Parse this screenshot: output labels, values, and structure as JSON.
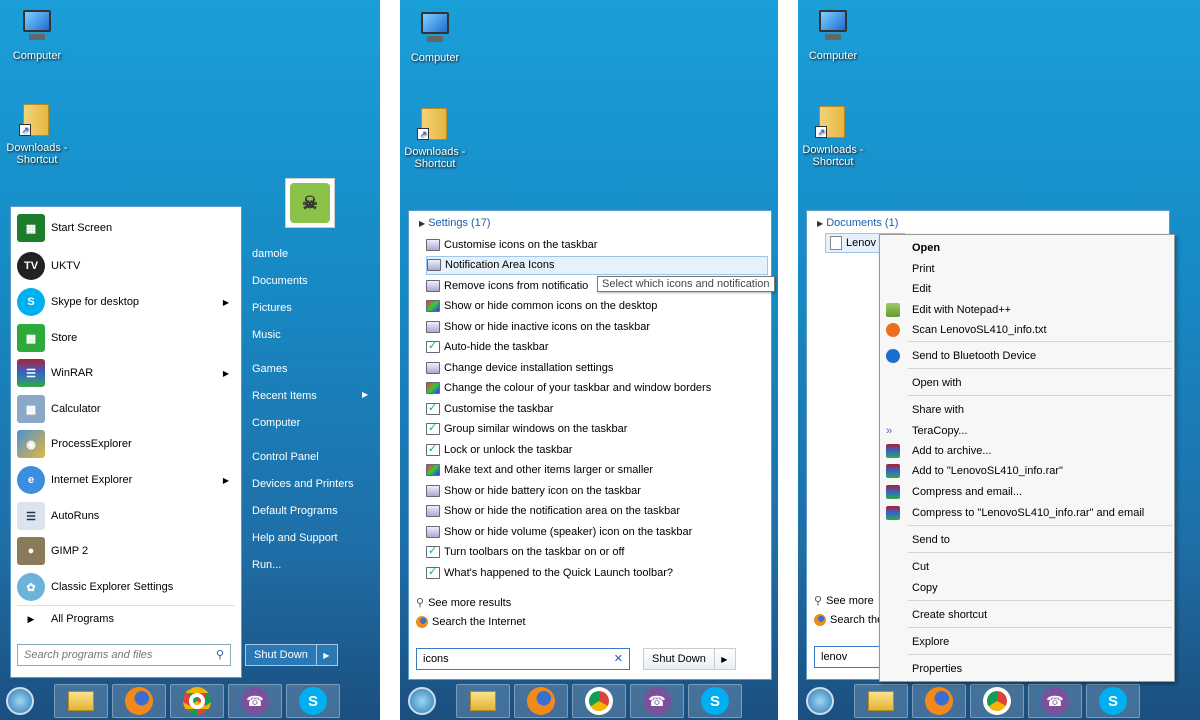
{
  "desktop": {
    "computer_label": "Computer",
    "downloads_label1": "Downloads -",
    "downloads_label2": "Shortcut"
  },
  "panel1": {
    "menu_items": [
      {
        "label": "Start Screen",
        "icon": "start-screen-icon"
      },
      {
        "label": "UKTV",
        "icon": "uktv-icon"
      },
      {
        "label": "Skype for desktop",
        "icon": "skype-icon",
        "arrow": true
      },
      {
        "label": "Store",
        "icon": "store-icon"
      },
      {
        "label": "WinRAR",
        "icon": "winrar-icon",
        "arrow": true
      },
      {
        "label": "Calculator",
        "icon": "calculator-icon"
      },
      {
        "label": "ProcessExplorer",
        "icon": "process-explorer-icon"
      },
      {
        "label": "Internet Explorer",
        "icon": "ie-icon",
        "arrow": true
      },
      {
        "label": "AutoRuns",
        "icon": "autoruns-icon"
      },
      {
        "label": "GIMP 2",
        "icon": "gimp-icon"
      },
      {
        "label": "Classic Explorer Settings",
        "icon": "classic-shell-icon"
      }
    ],
    "all_programs": "All Programs",
    "search_placeholder": "Search programs and files",
    "right_items": [
      "damole",
      "Documents",
      "Pictures",
      "Music",
      "Games",
      "Recent Items",
      "Computer",
      "Control Panel",
      "Devices and Printers",
      "Default Programs",
      "Help and Support",
      "Run..."
    ],
    "shutdown": "Shut Down"
  },
  "panel2": {
    "header": "Settings (17)",
    "results": [
      "Customise icons on the taskbar",
      "Notification Area Icons",
      "Remove icons from notificatio",
      "Show or hide common icons on the desktop",
      "Show or hide inactive icons on the taskbar",
      "Auto-hide the taskbar",
      "Change device installation settings",
      "Change the colour of your taskbar and window borders",
      "Customise the taskbar",
      "Group similar windows on the taskbar",
      "Lock or unlock the taskbar",
      "Make text and other items larger or smaller",
      "Show or hide battery icon on the taskbar",
      "Show or hide the notification area on the taskbar",
      "Show or hide volume (speaker) icon on the taskbar",
      "Turn toolbars on the taskbar on or off",
      "What's happened to the Quick Launch toolbar?"
    ],
    "tooltip": "Select which icons and notification",
    "see_more": "See more results",
    "search_internet": "Search the Internet",
    "search_value": "icons",
    "shutdown": "Shut Down"
  },
  "panel3": {
    "header": "Documents (1)",
    "file": "Lenov",
    "see_more": "See more",
    "search_internet": "Search the",
    "search_value": "lenov",
    "context_menu": {
      "open": "Open",
      "print": "Print",
      "edit": "Edit",
      "notepad": "Edit with Notepad++",
      "scan": "Scan LenovoSL410_info.txt",
      "bluetooth": "Send to Bluetooth Device",
      "open_with": "Open with",
      "share_with": "Share with",
      "teracopy": "TeraCopy...",
      "add_archive": "Add to archive...",
      "add_rar": "Add to \"LenovoSL410_info.rar\"",
      "compress_email": "Compress and email...",
      "compress_rar_email": "Compress to \"LenovoSL410_info.rar\" and email",
      "send_to": "Send to",
      "cut": "Cut",
      "copy": "Copy",
      "create_shortcut": "Create shortcut",
      "explore": "Explore",
      "properties": "Properties"
    }
  },
  "colors": {
    "accent": "#1a9fd9",
    "menu_border": "#5b9ccb",
    "link": "#1a5fb0"
  }
}
